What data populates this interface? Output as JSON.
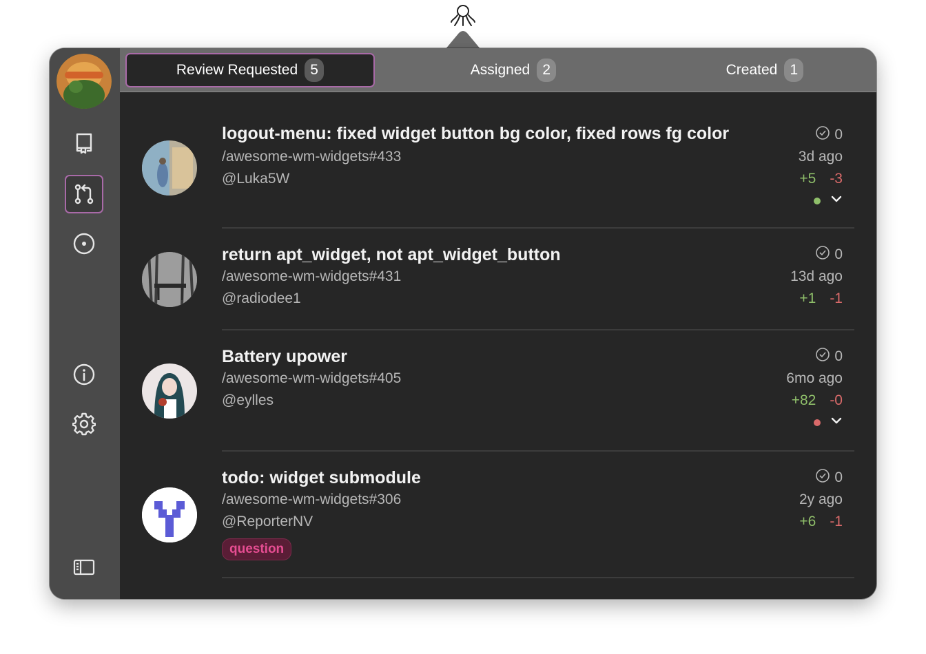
{
  "app": {
    "menubar_icon": "octopus-icon"
  },
  "sidebar": {
    "items": [
      {
        "name": "repository",
        "icon": "repo-icon"
      },
      {
        "name": "pull-requests",
        "icon": "git-pull-request-icon",
        "active": true
      },
      {
        "name": "issues",
        "icon": "issue-circle-icon"
      },
      {
        "name": "info",
        "icon": "info-icon"
      },
      {
        "name": "settings",
        "icon": "gear-icon"
      },
      {
        "name": "toggle-sidebar",
        "icon": "sidebar-toggle-icon"
      }
    ]
  },
  "tabs": [
    {
      "label": "Review Requested",
      "count": "5",
      "active": true
    },
    {
      "label": "Assigned",
      "count": "2"
    },
    {
      "label": "Created",
      "count": "1"
    }
  ],
  "pull_requests": [
    {
      "title": "logout-menu: fixed widget button bg color, fixed rows fg color",
      "repo": "/awesome-wm-widgets#433",
      "author": "@Luka5W",
      "approvals": "0",
      "age": "3d ago",
      "additions": "+5",
      "deletions": "-3",
      "status_color": "#8fbf6a",
      "expandable": true
    },
    {
      "title": "return apt_widget, not apt_widget_button",
      "repo": "/awesome-wm-widgets#431",
      "author": "@radiodee1",
      "approvals": "0",
      "age": "13d ago",
      "additions": "+1",
      "deletions": "-1"
    },
    {
      "title": "Battery upower",
      "repo": "/awesome-wm-widgets#405",
      "author": "@eylles",
      "approvals": "0",
      "age": "6mo ago",
      "additions": "+82",
      "deletions": "-0",
      "status_color": "#d96a6a",
      "expandable": true
    },
    {
      "title": "todo: widget submodule",
      "repo": "/awesome-wm-widgets#306",
      "author": "@ReporterNV",
      "approvals": "0",
      "age": "2y ago",
      "additions": "+6",
      "deletions": "-1",
      "label": "question"
    }
  ],
  "colors": {
    "accent_border": "#a96aa8",
    "additions": "#8fbf6a",
    "deletions": "#d96a6a",
    "label_text": "#e64d92"
  }
}
